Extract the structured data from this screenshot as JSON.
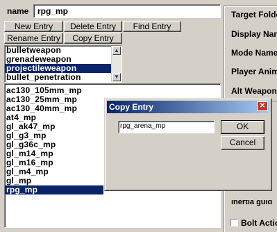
{
  "name_label": "name",
  "name_value": "rpg_mp",
  "buttons": {
    "new_entry": "New Entry",
    "delete_entry": "Delete Entry",
    "find_entry": "Find Entry",
    "rename_entry": "Rename Entry",
    "copy_entry": "Copy Entry"
  },
  "type_list": [
    "bulletweapon",
    "grenadeweapon",
    "projectileweapon",
    "bullet_penetration"
  ],
  "entry_list": [
    "ac130_105mm_mp",
    "ac130_25mm_mp",
    "ac130_40mm_mp",
    "at4_mp",
    "gl_ak47_mp",
    "gl_g3_mp",
    "gl_g36c_mp",
    "gl_m14_mp",
    "gl_m16_mp",
    "gl_m4_mp",
    "gl_mp",
    "rpg_mp"
  ],
  "right_labels": [
    "Target Folde",
    "Display Nan",
    "Mode Name",
    "Player Anim",
    "Alt Weapon",
    "Bolt Actio"
  ],
  "right_partial": "inertia guid",
  "dialog": {
    "title": "Copy Entry",
    "input_value": "rpg_arena_mp",
    "ok_label": "OK",
    "cancel_label": "Cancel",
    "close_glyph": "✕"
  }
}
